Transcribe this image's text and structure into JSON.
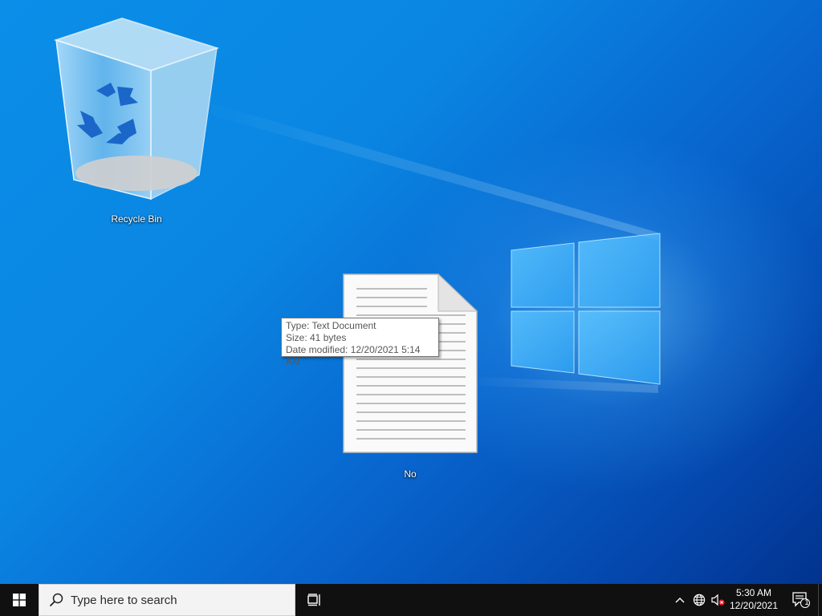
{
  "desktop": {
    "icons": [
      {
        "label": "Recycle Bin",
        "icon": "recycle-bin-icon"
      },
      {
        "label": "No",
        "icon": "text-document-icon"
      }
    ],
    "tooltip": {
      "type_line": "Type: Text Document",
      "size_line": "Size: 41 bytes",
      "modified_line": "Date modified: 12/20/2021 5:14 AM"
    }
  },
  "taskbar": {
    "start_icon": "windows-logo-icon",
    "search_placeholder": "Type here to search",
    "task_view_icon": "task-view-icon",
    "tray": {
      "chevron_icon": "chevron-up-icon",
      "network_icon": "network-globe-icon",
      "volume_icon": "volume-muted-icon",
      "time": "5:30 AM",
      "date": "12/20/2021",
      "notification_count": "1"
    }
  },
  "colors": {
    "desktop_blue": "#0a86e2",
    "taskbar": "#101010"
  }
}
